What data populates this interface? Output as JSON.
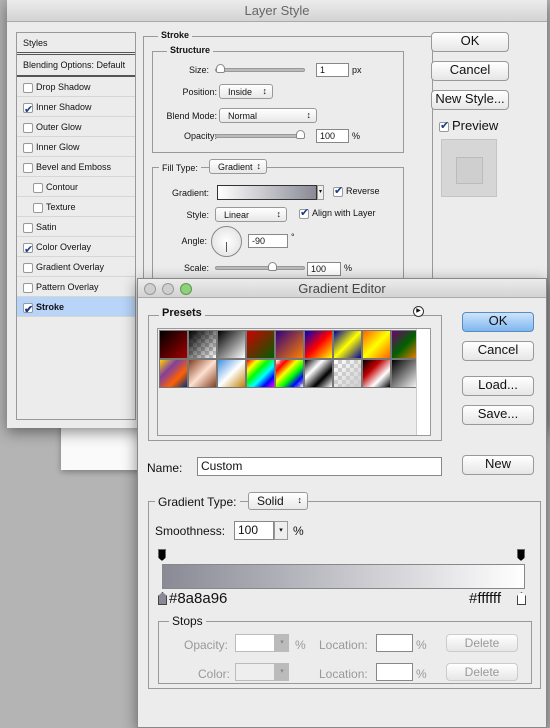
{
  "layer_style": {
    "title": "Layer Style",
    "styles_header": "Styles",
    "blending_options": "Blending Options: Default",
    "items": [
      {
        "label": "Drop Shadow",
        "checked": false,
        "sub": false
      },
      {
        "label": "Inner Shadow",
        "checked": true,
        "sub": false
      },
      {
        "label": "Outer Glow",
        "checked": false,
        "sub": false
      },
      {
        "label": "Inner Glow",
        "checked": false,
        "sub": false
      },
      {
        "label": "Bevel and Emboss",
        "checked": false,
        "sub": false
      },
      {
        "label": "Contour",
        "checked": false,
        "sub": true
      },
      {
        "label": "Texture",
        "checked": false,
        "sub": true
      },
      {
        "label": "Satin",
        "checked": false,
        "sub": false
      },
      {
        "label": "Color Overlay",
        "checked": true,
        "sub": false
      },
      {
        "label": "Gradient Overlay",
        "checked": false,
        "sub": false
      },
      {
        "label": "Pattern Overlay",
        "checked": false,
        "sub": false
      },
      {
        "label": "Stroke",
        "checked": true,
        "sub": false,
        "selected": true
      }
    ],
    "stroke": {
      "title": "Stroke",
      "structure": "Structure",
      "size_label": "Size:",
      "size": "1",
      "size_unit": "px",
      "size_fraction": 0.0,
      "position_label": "Position:",
      "position": "Inside",
      "blend_label": "Blend Mode:",
      "blend": "Normal",
      "opacity_label": "Opacity:",
      "opacity": "100",
      "opacity_unit": "%",
      "opacity_fraction": 1.0,
      "fill_type_label": "Fill Type:",
      "fill_type": "Gradient",
      "gradient_label": "Gradient:",
      "reverse_label": "Reverse",
      "reverse": true,
      "style_label": "Style:",
      "style": "Linear",
      "align_label": "Align with Layer",
      "align": true,
      "angle_label": "Angle:",
      "angle": "-90",
      "angle_unit": "°",
      "scale_label": "Scale:",
      "scale": "100",
      "scale_unit": "%"
    },
    "buttons": {
      "ok": "OK",
      "cancel": "Cancel",
      "new_style": "New Style..."
    },
    "preview_label": "Preview",
    "preview": true
  },
  "gradient_editor": {
    "title": "Gradient Editor",
    "presets_label": "Presets",
    "presets": [
      [
        "#000",
        "#a00000"
      ],
      [
        "#000",
        "transparent"
      ],
      [
        "#000",
        "#fff"
      ],
      [
        "#d00000",
        "#006000"
      ],
      [
        "#300080",
        "#ff8000"
      ],
      [
        "#0000c0",
        "#ff0000",
        "#ffff00"
      ],
      [
        "#0000a0",
        "#ffff00",
        "#0000a0"
      ],
      [
        "#ff6000",
        "#ffff00",
        "#ff6000"
      ],
      [
        "#700070",
        "#006000",
        "#ff8000"
      ],
      [
        "#ffd000",
        "#8040a0",
        "#ff6000",
        "#003080"
      ],
      [
        "#804020",
        "#ffe0d0",
        "#804020"
      ],
      [
        "#4090e0",
        "#fff",
        "#c08000"
      ],
      [
        "#ff0000",
        "#ffff00",
        "#00ff00",
        "#00ffff",
        "#0000ff",
        "#ff00ff"
      ],
      [
        "transparent",
        "#ff0000",
        "#ffff00",
        "#00ff00",
        "#0000ff",
        "transparent"
      ],
      [
        "#000",
        "#fff",
        "#000",
        "#fff"
      ],
      [
        "transparent",
        "#ccc"
      ],
      [
        "#000",
        "#c00000",
        "#fff",
        "#000"
      ],
      [
        "#000",
        "#fff"
      ]
    ],
    "buttons": {
      "ok": "OK",
      "cancel": "Cancel",
      "load": "Load...",
      "save": "Save...",
      "new": "New"
    },
    "name_label": "Name:",
    "name": "Custom",
    "gradient_type_label": "Gradient Type:",
    "gradient_type": "Solid",
    "smoothness_label": "Smoothness:",
    "smoothness": "100",
    "smoothness_unit": "%",
    "start_color": "#8a8a96",
    "end_color": "#ffffff",
    "stops": {
      "title": "Stops",
      "opacity_label": "Opacity:",
      "opacity_unit": "%",
      "color_label": "Color:",
      "location_label": "Location:",
      "location_unit": "%",
      "delete": "Delete"
    }
  }
}
